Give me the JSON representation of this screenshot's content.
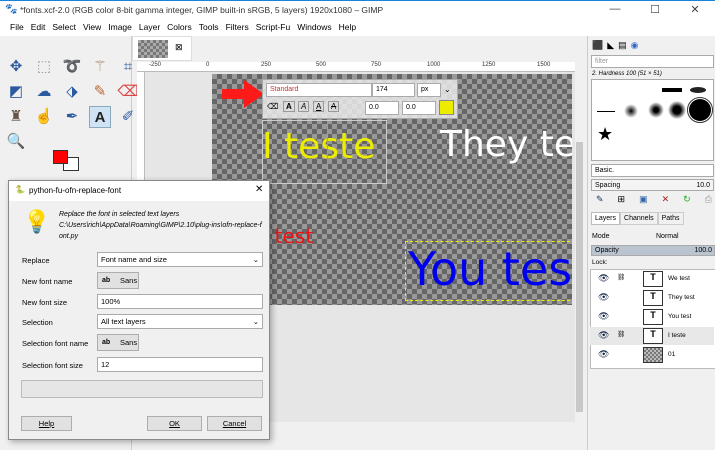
{
  "window": {
    "title": "*fonts.xcf-2.0 (RGB color 8-bit gamma integer, GIMP built-in sRGB, 5 layers) 1920x1080 – GIMP",
    "minimize": "—",
    "maximize": "☐",
    "close": "✕"
  },
  "menu": [
    "File",
    "Edit",
    "Select",
    "View",
    "Image",
    "Layer",
    "Colors",
    "Tools",
    "Filters",
    "Script-Fu",
    "Windows",
    "Help"
  ],
  "ruler": [
    "-250",
    "0",
    "250",
    "500",
    "750",
    "1000",
    "1250",
    "1500"
  ],
  "text_toolbar": {
    "font": "Standard",
    "size": "174",
    "unit": "px",
    "baseline": "0.0",
    "kerning": "0.0",
    "color": "#ecec00"
  },
  "canvas_texts": {
    "layer1": "I teste",
    "layer2": "They  test",
    "layer3": "e test",
    "layer4": "You test"
  },
  "dialog": {
    "title": "python-fu-ofn-replace-font",
    "description": "Replace the font in selected text layers",
    "path": "C:\\Users\\rich\\AppData\\Roaming\\GIMP\\2.10\\plug-ins\\ofn-replace-font.py",
    "fields": {
      "replace_label": "Replace",
      "replace_value": "Font name and size",
      "new_font_name_label": "New font name",
      "new_font_name": "Sans",
      "new_font_size_label": "New font size",
      "new_font_size": "100%",
      "selection_label": "Selection",
      "selection_value": "All text layers",
      "selection_font_name_label": "Selection font name",
      "selection_font_name": "Sans",
      "selection_font_size_label": "Selection font size",
      "selection_font_size": "12"
    },
    "buttons": {
      "help": "Help",
      "ok": "OK",
      "cancel": "Cancel"
    },
    "close": "✕"
  },
  "brushes": {
    "filter_placeholder": "filter",
    "brush_name": "2. Hardness 100 (51 × 51)",
    "preset": "Basic.",
    "spacing_label": "Spacing",
    "spacing_value": "10.0"
  },
  "layers_panel": {
    "tabs": [
      "Layers",
      "Channels",
      "Paths"
    ],
    "mode_label": "Mode",
    "mode_value": "Normal",
    "opacity_label": "Opacity",
    "opacity_value": "100.0",
    "lock_label": "Lock:",
    "layers": [
      {
        "name": "We test",
        "linked": true
      },
      {
        "name": "They  test",
        "linked": false
      },
      {
        "name": "You test",
        "linked": false
      },
      {
        "name": "I teste",
        "linked": true,
        "selected": true
      },
      {
        "name": "01",
        "linked": false
      }
    ]
  },
  "colors": {
    "foreground": "#ff0000",
    "background": "#ffffff"
  }
}
